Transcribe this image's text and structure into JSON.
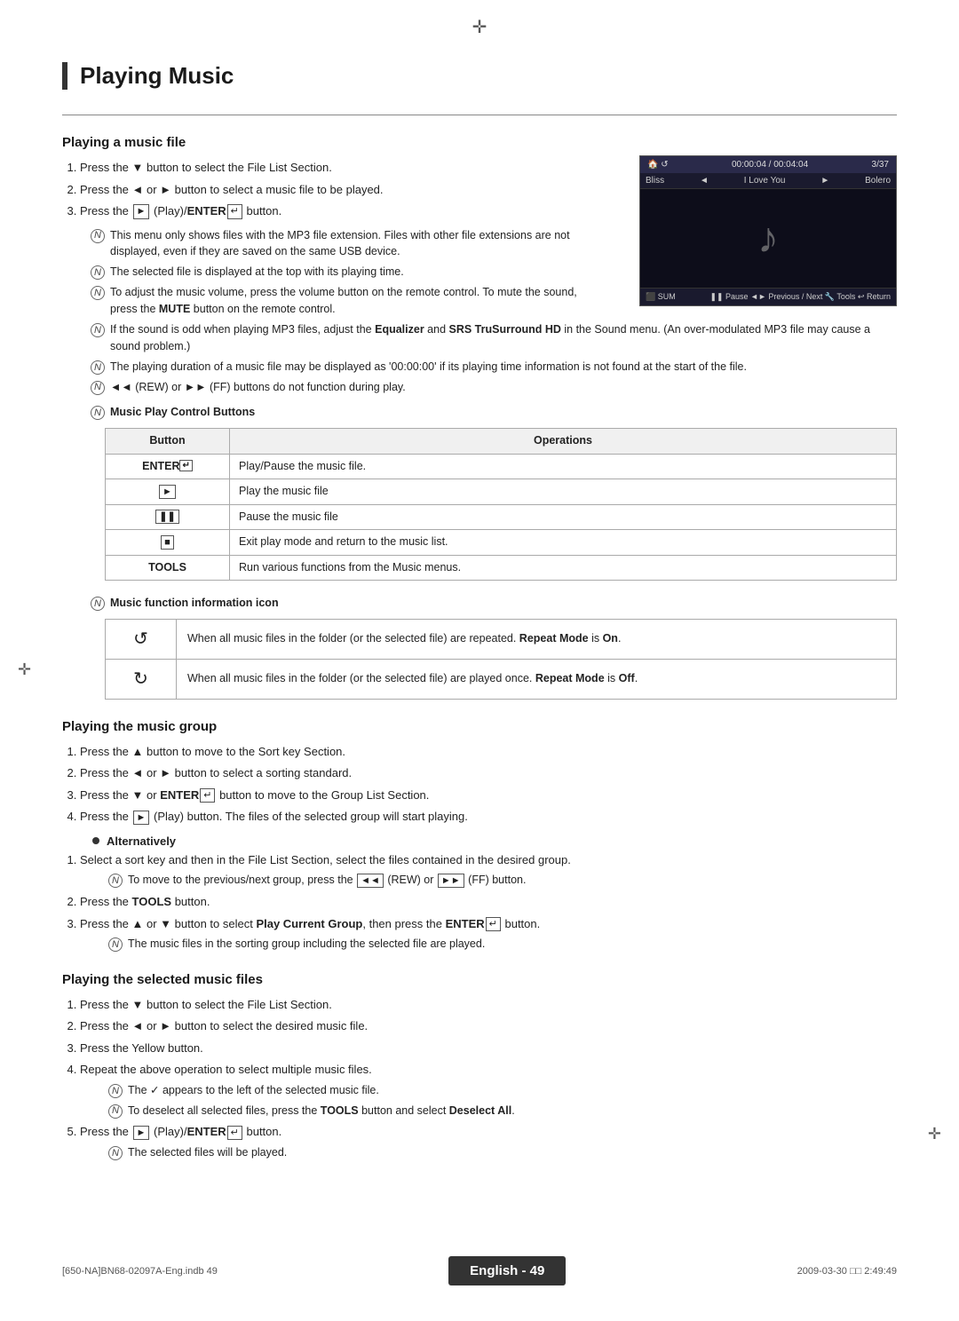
{
  "page": {
    "title": "Playing Music",
    "compass_top": "✛",
    "compass_left": "✛",
    "compass_right": "✛"
  },
  "section1": {
    "heading": "Playing a music file",
    "steps": [
      "Press the ▼ button to select the File List Section.",
      "Press the ◄ or ► button to select a music file to be played.",
      "Press the  ► (Play)/ENTER  button."
    ],
    "notes": [
      "This menu only shows files with the MP3 file extension. Files with other file extensions are not displayed, even if they are saved on the same USB device.",
      "The selected file is displayed at the top with its playing time.",
      "To adjust the music volume, press the volume button on the remote control. To mute the sound, press the MUTE button on the remote control.",
      "If the sound is odd when playing MP3 files, adjust the Equalizer and SRS TruSurround HD in the Sound menu. (An over-modulated MP3 file may cause a sound problem.)",
      "The playing duration of a music file may be displayed as '00:00:00' if its playing time information is not found at the start of the file.",
      "◄◄ (REW) or ►► (FF) buttons do not function during play."
    ],
    "table_heading": "Music Play Control Buttons",
    "table_cols": [
      "Button",
      "Operations"
    ],
    "table_rows": [
      [
        "ENTER  ",
        "Play/Pause the music file."
      ],
      [
        "►",
        "Play the music file"
      ],
      [
        "❚❚",
        "Pause the music file"
      ],
      [
        "■",
        "Exit play mode and return to the music list."
      ],
      [
        "TOOLS",
        "Run various functions from the Music menus."
      ]
    ],
    "icon_table_heading": "Music function information icon",
    "icon_table_rows": [
      [
        "↺",
        "When all music files in the folder (or the selected file) are repeated. Repeat Mode is On."
      ],
      [
        "↻",
        "When all music files in the folder (or the selected file) are played once. Repeat Mode is Off."
      ]
    ]
  },
  "section2": {
    "heading": "Playing the music group",
    "steps": [
      "Press the ▲ button to move to the Sort key Section.",
      "Press the ◄ or ► button to select a sorting standard.",
      "Press the ▼ or ENTER  button to move to the Group List Section.",
      "Press the ► (Play) button. The files of the selected group will start playing."
    ],
    "alternatively_label": "Alternatively",
    "alt_steps": [
      "Select a sort key and then in the File List Section, select the files contained in the desired group."
    ],
    "alt_notes": [
      "To move to the previous/next group, press the ◄◄ (REW) or ►► (FF) button."
    ],
    "alt_steps2": [
      "Press the TOOLS button.",
      "Press the ▲ or ▼ button to select Play Current Group, then press the ENTER  button."
    ],
    "alt_notes2": [
      "The music files in the sorting group including the selected file are played."
    ]
  },
  "section3": {
    "heading": "Playing the selected music files",
    "steps": [
      "Press the ▼ button to select the File List Section.",
      "Press the ◄ or ► button to select the desired music file.",
      "Press the Yellow button.",
      "Repeat the above operation to select multiple music files."
    ],
    "step4_notes": [
      "The ✓ appears to the left of the selected music file.",
      "To deselect all selected files, press the TOOLS button and select Deselect All."
    ],
    "step5": "Press the ► (Play)/ENTER  button.",
    "step5_note": "The selected files will be played."
  },
  "footer": {
    "left": "[650-NA]BN68-02097A-Eng.indb  49",
    "center": "English - 49",
    "right": "2009-03-30   □□  2:49:49"
  },
  "player": {
    "time": "00:00:04 / 00:04:04",
    "track_num": "3/37",
    "prev_track": "Bliss",
    "current_track": "I Love You",
    "next_track": "Bolero"
  }
}
